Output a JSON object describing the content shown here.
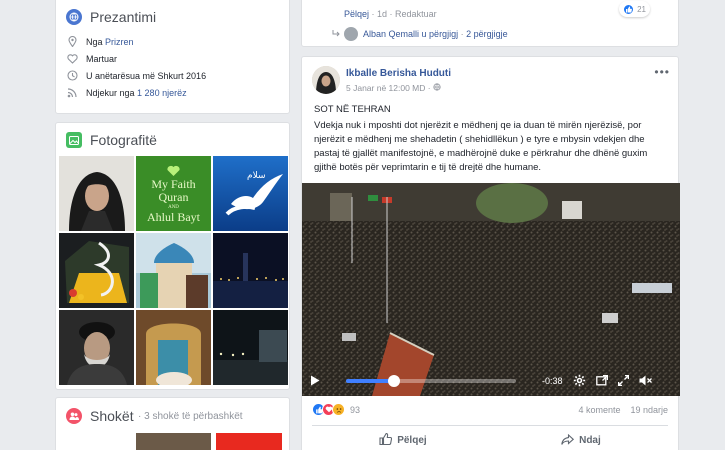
{
  "intro": {
    "title": "Prezantimi",
    "rows": [
      {
        "icon": "location-pin-icon",
        "prefix": "Nga",
        "link": "Prizren"
      },
      {
        "icon": "heart-icon",
        "text": "Martuar"
      },
      {
        "icon": "clock-icon",
        "text": "U anëtarësua më Shkurt 2016"
      },
      {
        "icon": "rss-icon",
        "prefix": "Ndjekur nga",
        "link": "1 280 njerëz"
      }
    ]
  },
  "photos": {
    "title": "Fotografitë",
    "faith_text": {
      "line1": "My Faith",
      "line2": "Quran",
      "and": "AND",
      "line3": "Ahlul Bayt"
    },
    "dove_caption": "سلام"
  },
  "friends": {
    "title": "Shokët",
    "subtitle": "· 3 shokë të përbashkët"
  },
  "top_comment": {
    "like": "Pëlqej",
    "age": "1d",
    "edit": "Redaktuar",
    "reaction_count": "21",
    "reply_author": "Alban Qemalli",
    "reply_text": "u përgjigj",
    "reply_count": "2 përgjigje"
  },
  "post": {
    "author": "Ikballe Berisha Huduti",
    "date": "5 Janar në 12:00 MD",
    "title_line": "SOT NË TEHRAN",
    "body": "Vdekja nuk i mposhti dot njerëzit e mëdhenj qe ia duan të mirën njerëzisë, por njerëzit e mëdhenj me shehadetin ( shehidllëkun ) e tyre e mbysin vdekjen dhe pastaj të gjallët manifestojnë, e madhërojnë duke e përkrahur dhe dhënë guxim gjithë botës për veprimtarin e tij të drejtë dhe humane.",
    "video": {
      "time_remaining": "-0:38",
      "progress": 0.28
    },
    "reactions_count": "93",
    "comments": "4 komente",
    "shares": "19 ndarje",
    "like_label": "Pëlqej",
    "share_label": "Ndaj"
  }
}
